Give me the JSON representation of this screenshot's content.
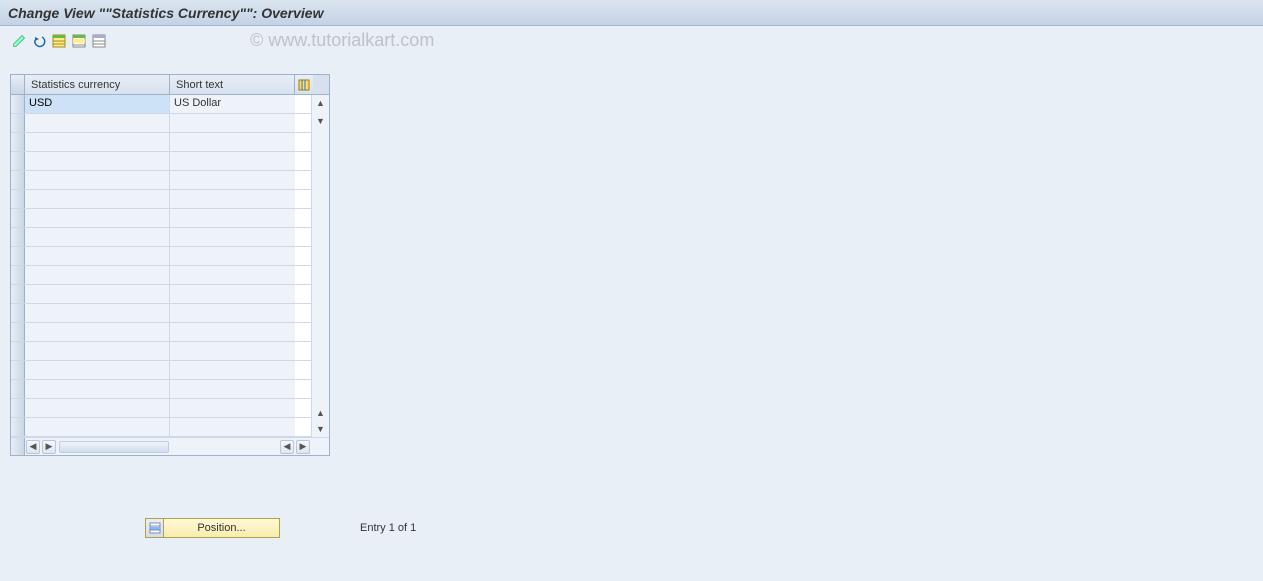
{
  "title": "Change View \"\"Statistics Currency\"\": Overview",
  "watermark": "© www.tutorialkart.com",
  "columns": {
    "col1": "Statistics currency",
    "col2": "Short text"
  },
  "rows": [
    {
      "currency": "USD",
      "short_text": "US Dollar"
    }
  ],
  "emptyRowCount": 17,
  "footer": {
    "position_label": "Position...",
    "entry_text": "Entry 1 of 1"
  }
}
